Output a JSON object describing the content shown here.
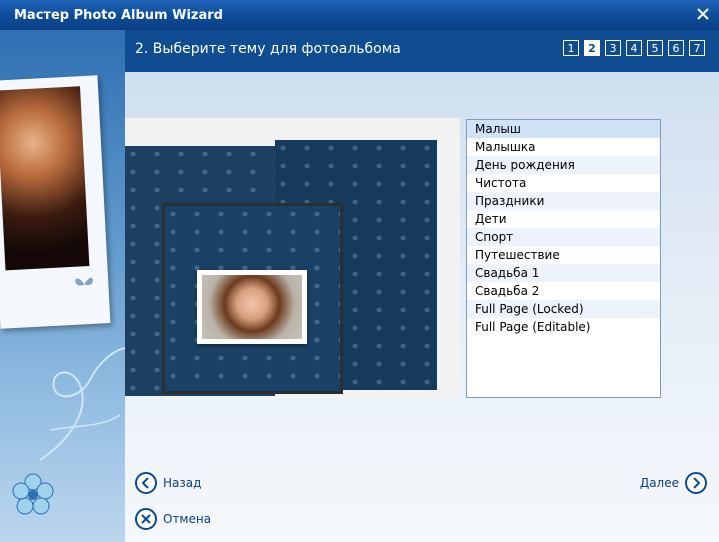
{
  "window": {
    "title": "Мастер Photo Album Wizard"
  },
  "header": {
    "step_title": "2. Выберите тему для фотоальбома"
  },
  "steps": [
    "1",
    "2",
    "3",
    "4",
    "5",
    "6",
    "7"
  ],
  "active_step": "2",
  "themes": [
    "Малыш",
    "Малышка",
    "День рождения",
    "Чистота",
    "Праздники",
    "Дети",
    "Спорт",
    "Путешествие",
    "Свадьба 1",
    "Свадьба 2",
    "Full Page (Locked)",
    "Full Page (Editable)"
  ],
  "selected_theme": "Малыш",
  "buttons": {
    "back": "Назад",
    "next": "Далее",
    "cancel": "Отмена"
  },
  "colors": {
    "titlebar": "#0d4a97",
    "header": "#0f4c92",
    "accent": "#0b4a8f"
  }
}
